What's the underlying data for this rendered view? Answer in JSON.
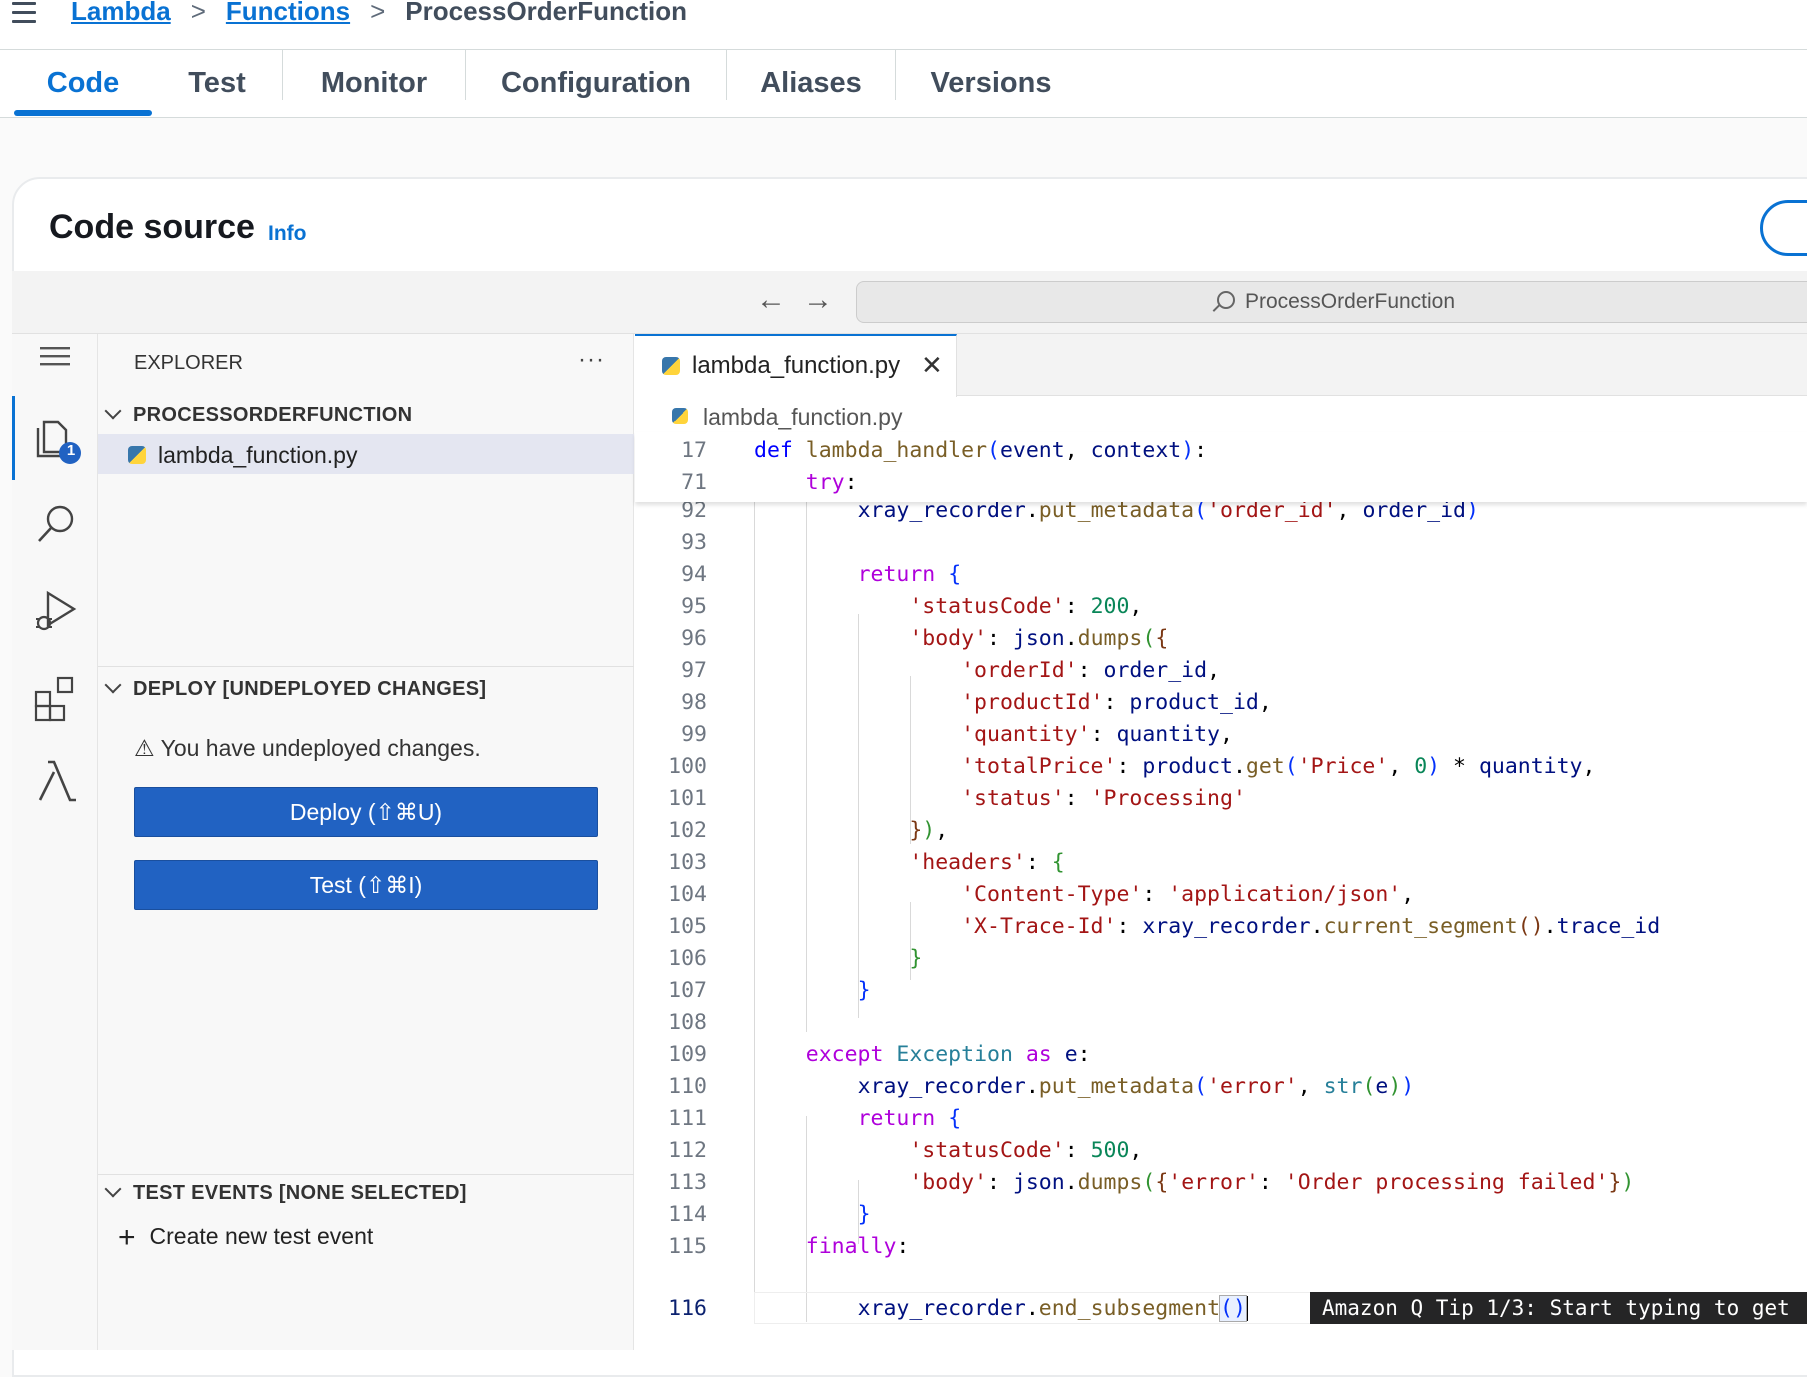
{
  "breadcrumb": {
    "items": [
      "Lambda",
      "Functions"
    ],
    "current": "ProcessOrderFunction"
  },
  "tabs": [
    "Code",
    "Test",
    "Monitor",
    "Configuration",
    "Aliases",
    "Versions"
  ],
  "active_tab": "Code",
  "code_source": {
    "title": "Code source",
    "info_label": "Info"
  },
  "ide": {
    "search_text": "ProcessOrderFunction",
    "explorer_title": "EXPLORER",
    "project_name": "PROCESSORDERFUNCTION",
    "file_name": "lambda_function.py",
    "explorer_badge": "1",
    "deploy_section": "DEPLOY [UNDEPLOYED CHANGES]",
    "undeployed_msg": "You have undeployed changes.",
    "deploy_button": "Deploy (⇧⌘U)",
    "test_button": "Test (⇧⌘I)",
    "test_events_section": "TEST EVENTS [NONE SELECTED]",
    "create_test_event": "Create new test event",
    "editor_tab": "lambda_function.py",
    "editor_breadcrumb": "lambda_function.py",
    "tip": "Amazon Q Tip 1/3: Start typing to get"
  },
  "code": {
    "sticky": [
      {
        "n": "17",
        "text": "def lambda_handler(event, context):"
      },
      {
        "n": "71",
        "text": "    try:"
      }
    ],
    "lines": [
      {
        "n": "92",
        "text": "        xray_recorder.put_metadata('order_id', order_id)"
      },
      {
        "n": "93",
        "text": ""
      },
      {
        "n": "94",
        "text": "        return {"
      },
      {
        "n": "95",
        "text": "            'statusCode': 200,"
      },
      {
        "n": "96",
        "text": "            'body': json.dumps({"
      },
      {
        "n": "97",
        "text": "                'orderId': order_id,"
      },
      {
        "n": "98",
        "text": "                'productId': product_id,"
      },
      {
        "n": "99",
        "text": "                'quantity': quantity,"
      },
      {
        "n": "100",
        "text": "                'totalPrice': product.get('Price', 0) * quantity,"
      },
      {
        "n": "101",
        "text": "                'status': 'Processing'"
      },
      {
        "n": "102",
        "text": "            }),"
      },
      {
        "n": "103",
        "text": "            'headers': {"
      },
      {
        "n": "104",
        "text": "                'Content-Type': 'application/json',"
      },
      {
        "n": "105",
        "text": "                'X-Trace-Id': xray_recorder.current_segment().trace_id"
      },
      {
        "n": "106",
        "text": "            }"
      },
      {
        "n": "107",
        "text": "        }"
      },
      {
        "n": "108",
        "text": ""
      },
      {
        "n": "109",
        "text": "    except Exception as e:"
      },
      {
        "n": "110",
        "text": "        xray_recorder.put_metadata('error', str(e))"
      },
      {
        "n": "111",
        "text": "        return {"
      },
      {
        "n": "112",
        "text": "            'statusCode': 500,"
      },
      {
        "n": "113",
        "text": "            'body': json.dumps({'error': 'Order processing failed'})"
      },
      {
        "n": "114",
        "text": "        }"
      },
      {
        "n": "115",
        "text": "    finally:"
      },
      {
        "n": "116",
        "text": "        xray_recorder.end_subsegment()"
      }
    ]
  },
  "colors": {
    "accent": "#0972d3",
    "button": "#2162c2"
  }
}
